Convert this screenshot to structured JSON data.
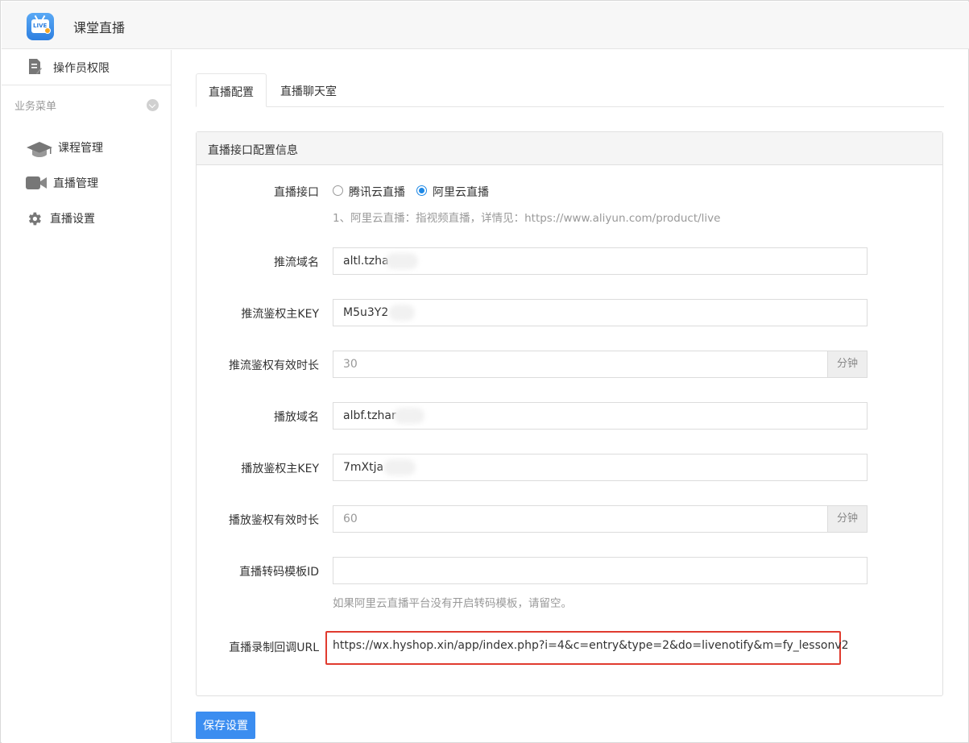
{
  "header": {
    "app_title": "课堂直播",
    "app_icon": "live-tv-icon",
    "icon_text": "LIVE"
  },
  "sidebar": {
    "top_item": {
      "label": "操作员权限",
      "icon": "document-edit-icon"
    },
    "group_title": "业务菜单",
    "items": [
      {
        "label": "课程管理",
        "icon": "graduation-cap-icon"
      },
      {
        "label": "直播管理",
        "icon": "video-camera-icon"
      },
      {
        "label": "直播设置",
        "icon": "gear-icon"
      }
    ]
  },
  "tabs": [
    {
      "label": "直播配置",
      "active": true
    },
    {
      "label": "直播聊天室",
      "active": false
    }
  ],
  "panel": {
    "title": "直播接口配置信息",
    "fields": {
      "interface": {
        "label": "直播接口",
        "options": [
          {
            "label": "腾讯云直播",
            "checked": false
          },
          {
            "label": "阿里云直播",
            "checked": true
          }
        ],
        "hint": "1、阿里云直播：指视频直播，详情见：https://www.aliyun.com/product/live"
      },
      "push_domain": {
        "label": "推流域名",
        "value": "altl.tzha"
      },
      "push_key": {
        "label": "推流鉴权主KEY",
        "value": "M5u3Y2"
      },
      "push_valid": {
        "label": "推流鉴权有效时长",
        "value": "30",
        "unit": "分钟"
      },
      "play_domain": {
        "label": "播放域名",
        "value": "albf.tzhar"
      },
      "play_key": {
        "label": "播放鉴权主KEY",
        "value": "7mXtja"
      },
      "play_valid": {
        "label": "播放鉴权有效时长",
        "value": "60",
        "unit": "分钟"
      },
      "template_id": {
        "label": "直播转码模板ID",
        "value": "",
        "hint": "如果阿里云直播平台没有开启转码模板，请留空。"
      },
      "callback_url": {
        "label": "直播录制回调URL",
        "value": "https://wx.hyshop.xin/app/index.php?i=4&c=entry&type=2&do=livenotify&m=fy_lessonv2"
      }
    }
  },
  "save_button": "保存设置",
  "colors": {
    "accent": "#3b8df0",
    "highlight_border": "#e03b2f",
    "radio_on": "#1e88e5"
  }
}
